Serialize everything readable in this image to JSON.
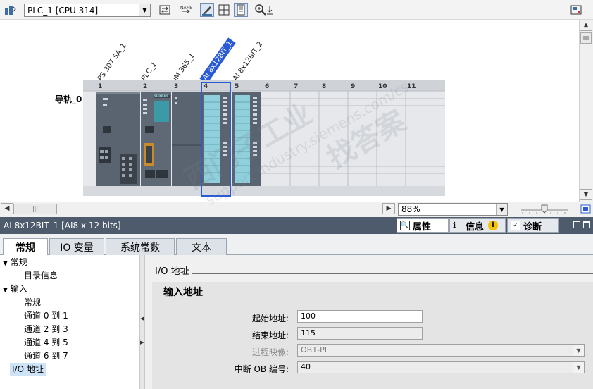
{
  "toolbar": {
    "device_select": "PLC_1 [CPU 314]",
    "icons": [
      "network-view-icon",
      "select-dropdown-icon",
      "swap-icon",
      "show-names-icon",
      "pen-icon",
      "grid-icon",
      "page-icon",
      "zoom-in-icon",
      "zoom-down-icon",
      "overview-icon"
    ]
  },
  "rack": {
    "rail_label": "导轨_0",
    "slot_numbers": [
      "1",
      "2",
      "3",
      "4",
      "5",
      "6",
      "7",
      "8",
      "9",
      "10",
      "11"
    ],
    "modules": [
      {
        "name": "PS 307 5A_1"
      },
      {
        "name": "PLC_1"
      },
      {
        "name": "IM 365_1"
      },
      {
        "name": "AI 8x12BIT_1",
        "selected": true
      },
      {
        "name": "AI 8x12BIT_2"
      }
    ],
    "brand": "SIEMENS"
  },
  "zoom": {
    "value": "88%"
  },
  "watermark": {
    "main": "西门子工业",
    "sub": "找答案",
    "url": "support.industry.siemens.com/cs"
  },
  "panel": {
    "title": "AI 8x12BIT_1 [AI8 x 12 bits]",
    "right_tabs": [
      {
        "label": "属性",
        "icon": "properties-icon",
        "active": true
      },
      {
        "label": "信息",
        "icon": "info-icon",
        "active": false
      },
      {
        "label": "诊断",
        "icon": "diagnostics-icon",
        "active": false
      }
    ],
    "tabs": [
      {
        "label": "常规",
        "active": true
      },
      {
        "label": "IO 变量",
        "active": false
      },
      {
        "label": "系统常数",
        "active": false
      },
      {
        "label": "文本",
        "active": false
      }
    ],
    "tree": [
      {
        "label": "常规",
        "level": 0,
        "expanded": true
      },
      {
        "label": "目录信息",
        "level": 1
      },
      {
        "label": "输入",
        "level": 0,
        "expanded": true
      },
      {
        "label": "常规",
        "level": 1
      },
      {
        "label": "通道 0 到 1",
        "level": 1
      },
      {
        "label": "通道 2 到 3",
        "level": 1
      },
      {
        "label": "通道 4 到 5",
        "level": 1
      },
      {
        "label": "通道 6 到 7",
        "level": 1
      },
      {
        "label": "I/O 地址",
        "level": 0,
        "selected": true
      }
    ],
    "section_title": "I/O 地址",
    "group_title": "输入地址",
    "fields": {
      "start_label": "起始地址:",
      "start_value": "100",
      "end_label": "结束地址:",
      "end_value": "115",
      "image_label": "过程映像:",
      "image_value": "OB1-PI",
      "ob_label": "中断 OB 编号:",
      "ob_value": "40"
    }
  },
  "colors": {
    "accent": "#2a5bd7",
    "module_body": "#5a6470",
    "module_stripe": "#8fd0dc",
    "panel_header": "#4e5b6c"
  }
}
